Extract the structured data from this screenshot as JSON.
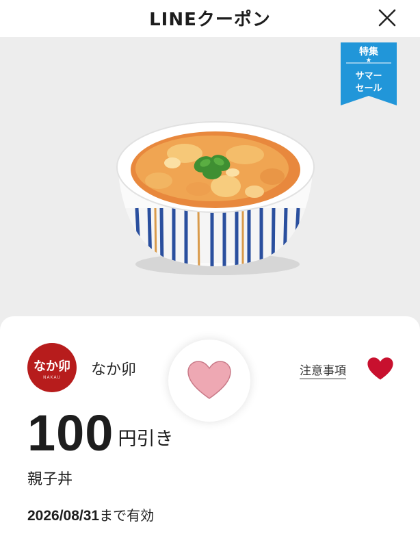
{
  "header": {
    "title": "LINEクーポン"
  },
  "ribbon": {
    "line1": "特集",
    "star": "★",
    "line2": "サマー",
    "line3": "セール",
    "color": "#2196d9"
  },
  "shop": {
    "logo_text": "なか卯",
    "logo_subtext": "NAKAU",
    "name": "なか卯",
    "brand_color": "#b71c1c"
  },
  "actions": {
    "notes_label": "注意事項",
    "heart_color": "#c8102e",
    "favorite_color": "#eea8b3"
  },
  "coupon": {
    "amount": "100",
    "unit": "円引き",
    "product": "親子丼",
    "expiry_date": "2026/08/31",
    "expiry_suffix": "まで有効"
  }
}
